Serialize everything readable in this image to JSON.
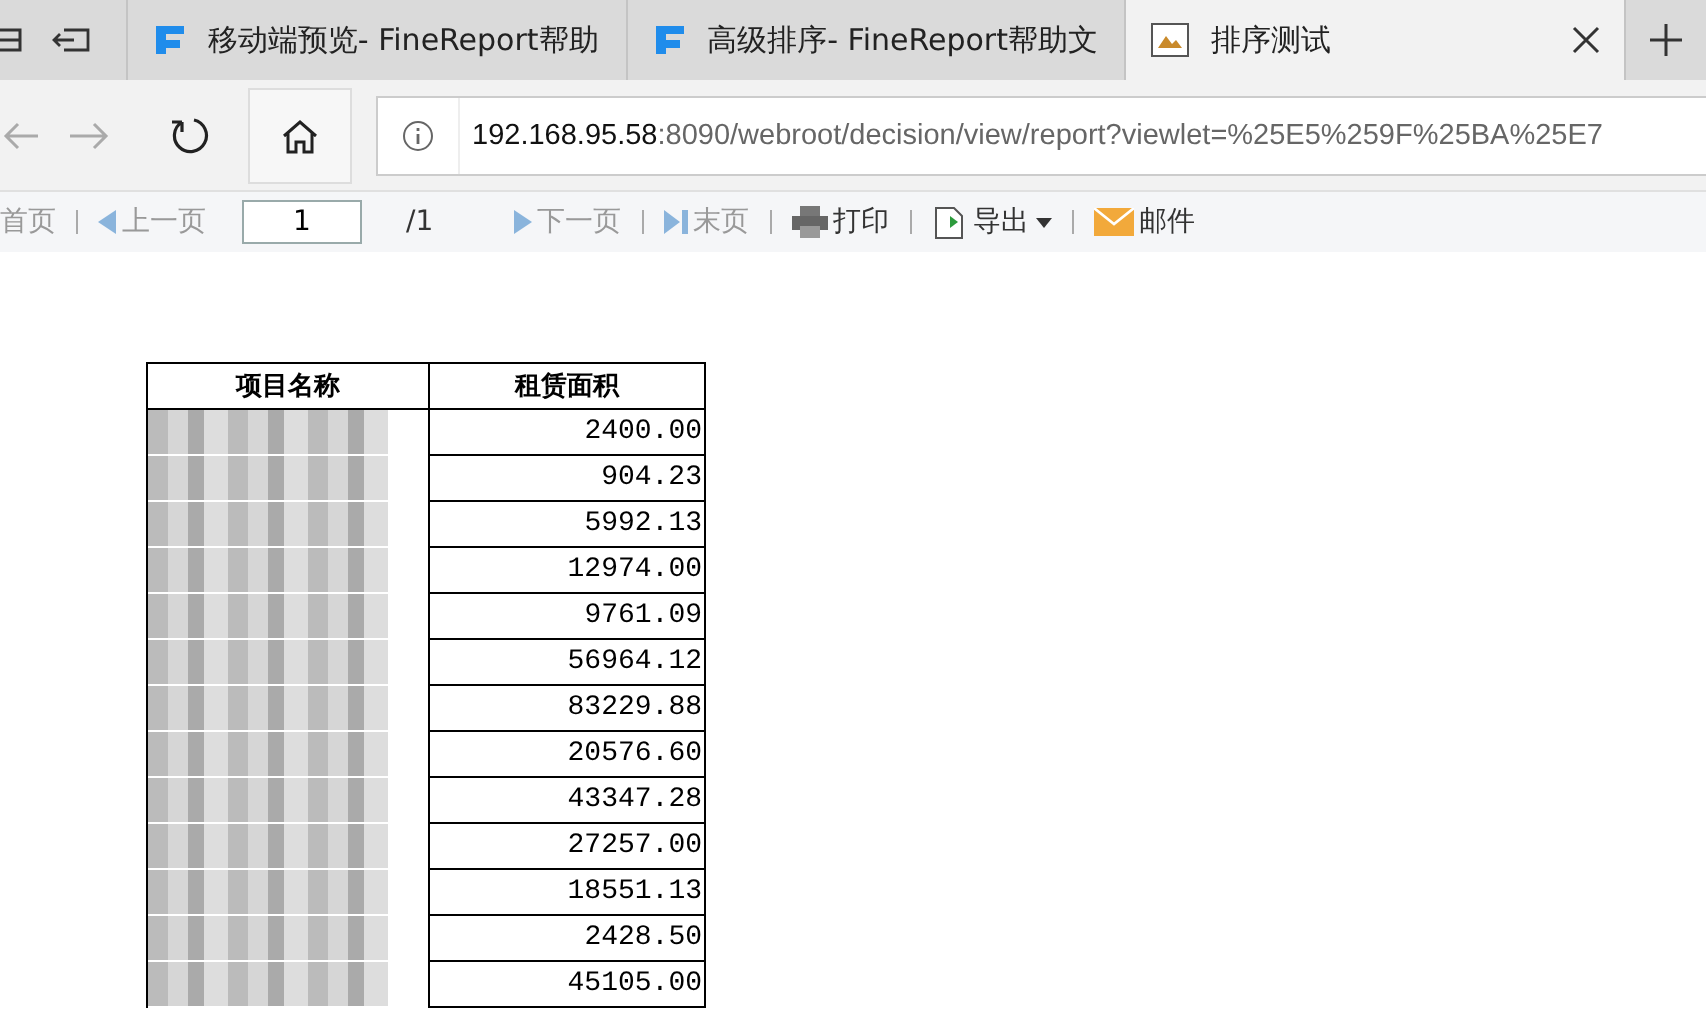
{
  "tabs": [
    {
      "title": "移动端预览- FineReport帮助",
      "selected": false,
      "kind": "fr"
    },
    {
      "title": "高级排序- FineReport帮助文",
      "selected": false,
      "kind": "fr"
    },
    {
      "title": "排序测试",
      "selected": true,
      "kind": "picture"
    }
  ],
  "address": {
    "host": "192.168.95.58",
    "rest": ":8090/webroot/decision/view/report?viewlet=%25E5%259F%25BA%25E7"
  },
  "toolbar": {
    "first": "首页",
    "prev": "上一页",
    "page": "1",
    "total": "/1",
    "next": "下一页",
    "last": "末页",
    "print": "打印",
    "export": "导出",
    "mail": "邮件"
  },
  "table": {
    "columns": [
      "项目名称",
      "租赁面积"
    ],
    "rows": [
      {
        "area": "2400.00"
      },
      {
        "area": "904.23"
      },
      {
        "area": "5992.13"
      },
      {
        "area": "12974.00"
      },
      {
        "area": "9761.09"
      },
      {
        "area": "56964.12"
      },
      {
        "area": "83229.88"
      },
      {
        "area": "20576.60"
      },
      {
        "area": "43347.28"
      },
      {
        "area": "27257.00"
      },
      {
        "area": "18551.13"
      },
      {
        "area": "2428.50"
      },
      {
        "area": "45105.00"
      }
    ]
  }
}
